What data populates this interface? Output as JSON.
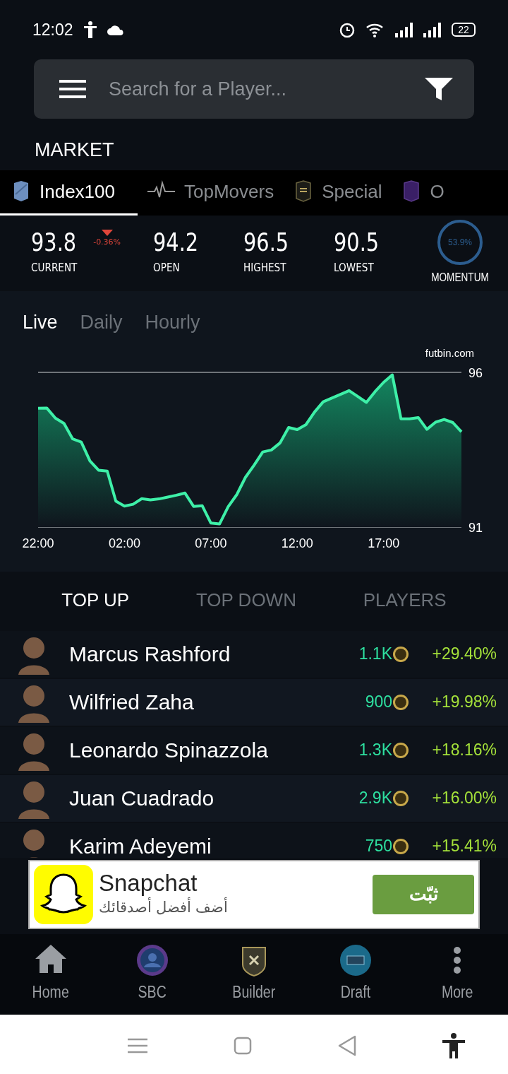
{
  "status_bar": {
    "time": "12:02",
    "battery": "22"
  },
  "search": {
    "placeholder": "Search for a Player..."
  },
  "section_title": "MARKET",
  "tabs": [
    {
      "label": "Index100",
      "selected": true,
      "kind": "index"
    },
    {
      "label": "TopMovers",
      "selected": false,
      "kind": "pulse"
    },
    {
      "label": "Special",
      "selected": false,
      "kind": "special"
    },
    {
      "label": "O",
      "selected": false,
      "kind": "other"
    }
  ],
  "stats": [
    {
      "value": "93.8",
      "label": "CURRENT",
      "change": "-0.36%",
      "falling": true
    },
    {
      "value": "94.2",
      "label": "OPEN"
    },
    {
      "value": "96.5",
      "label": "HIGHEST"
    },
    {
      "value": "90.5",
      "label": "LOWEST"
    }
  ],
  "momentum": {
    "value": "53.9%",
    "label": "MOMENTUM"
  },
  "range_tabs": [
    {
      "label": "Live",
      "selected": true
    },
    {
      "label": "Daily",
      "selected": false
    },
    {
      "label": "Hourly",
      "selected": false
    }
  ],
  "chart": {
    "source": "futbin.com",
    "chart_data": {
      "type": "area",
      "ylim": [
        91,
        96
      ],
      "yticks": [
        96,
        91
      ],
      "categories": [
        "22:00",
        null,
        null,
        null,
        null,
        null,
        null,
        null,
        null,
        null,
        "02:00",
        null,
        null,
        null,
        null,
        null,
        null,
        null,
        null,
        null,
        "07:00",
        null,
        null,
        null,
        null,
        null,
        null,
        null,
        null,
        null,
        "12:00",
        null,
        null,
        null,
        null,
        null,
        null,
        null,
        null,
        null,
        "17:00",
        null,
        null,
        null,
        null,
        null,
        null,
        null,
        null,
        null
      ],
      "series": [
        {
          "color": "#3ef0a8",
          "values": [
            94.84,
            94.85,
            94.52,
            94.35,
            93.85,
            93.75,
            93.14,
            92.84,
            92.81,
            91.84,
            91.68,
            91.74,
            91.92,
            91.88,
            91.91,
            91.97,
            92.03,
            92.1,
            91.67,
            91.69,
            91.13,
            91.1,
            91.66,
            92.05,
            92.61,
            93.0,
            93.43,
            93.49,
            93.72,
            94.22,
            94.15,
            94.31,
            94.72,
            95.05,
            95.17,
            95.29,
            95.41,
            95.22,
            95.03,
            95.38,
            95.68,
            95.92,
            94.5,
            94.5,
            94.54,
            94.16,
            94.39,
            94.48,
            94.38,
            94.08
          ]
        }
      ]
    }
  },
  "list_tabs": [
    {
      "label": "TOP UP",
      "selected": true
    },
    {
      "label": "TOP DOWN",
      "selected": false
    },
    {
      "label": "PLAYERS",
      "selected": false
    }
  ],
  "players": [
    {
      "name": "Marcus Rashford",
      "price": "1.1K",
      "change": "+29.40%"
    },
    {
      "name": "Wilfried Zaha",
      "price": "900",
      "change": "+19.98%"
    },
    {
      "name": "Leonardo Spinazzola",
      "price": "1.3K",
      "change": "+18.16%"
    },
    {
      "name": "Juan Cuadrado",
      "price": "2.9K",
      "change": "+16.00%"
    },
    {
      "name": "Karim Adeyemi",
      "price": "750",
      "change": "+15.41%"
    }
  ],
  "ad": {
    "title": "Snapchat",
    "subtitle": "أضف أفضل أصدقائك",
    "button": "ثبّت"
  },
  "bottom_nav": [
    {
      "label": "Home",
      "kind": "home"
    },
    {
      "label": "SBC",
      "kind": "sbc"
    },
    {
      "label": "Builder",
      "kind": "builder"
    },
    {
      "label": "Draft",
      "kind": "draft"
    },
    {
      "label": "More",
      "kind": "more"
    }
  ]
}
